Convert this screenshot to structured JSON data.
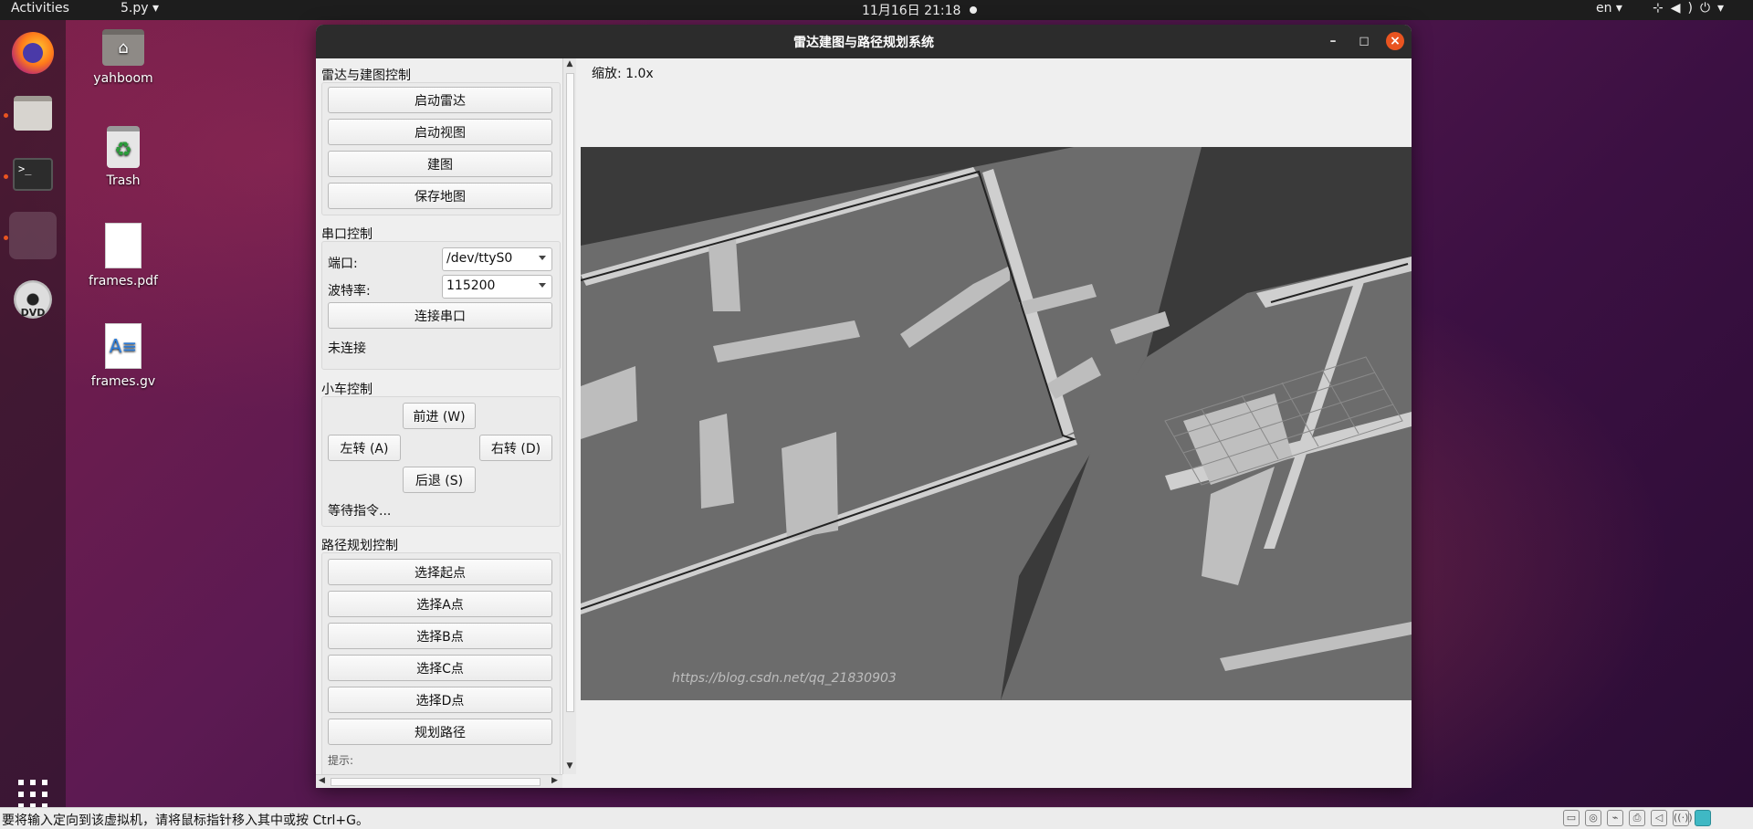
{
  "topbar": {
    "activities": "Activities",
    "app_menu": "5.py ▾",
    "clock": "11月16日  21:18",
    "language": "en ▾",
    "tray_icons": [
      "network-icon",
      "volume-icon",
      "power-icon"
    ]
  },
  "desktop": {
    "icons": [
      {
        "label": "yahboom",
        "icon": "home-folder-icon"
      },
      {
        "label": "Trash",
        "icon": "trash-icon"
      },
      {
        "label": "frames.pdf",
        "icon": "pdf-file-icon"
      },
      {
        "label": "frames.gv",
        "icon": "text-file-icon"
      }
    ]
  },
  "dock": {
    "items": [
      "firefox-icon",
      "files-icon",
      "terminal-icon",
      "python-app-icon",
      "dvd-icon",
      "show-apps-icon"
    ]
  },
  "window": {
    "title": "雷达建图与路径规划系统",
    "controls": {
      "minimize": "–",
      "maximize": "◻",
      "close": "×"
    }
  },
  "radar_group": {
    "title": "雷达与建图控制",
    "buttons": [
      "启动雷达",
      "启动视图",
      "建图",
      "保存地图"
    ]
  },
  "serial_group": {
    "title": "串口控制",
    "port_label": "端口:",
    "port_value": "/dev/ttyS0",
    "baud_label": "波特率:",
    "baud_value": "115200",
    "connect_button": "连接串口",
    "status": "未连接"
  },
  "car_group": {
    "title": "小车控制",
    "forward": "前进 (W)",
    "left": "左转 (A)",
    "right": "右转 (D)",
    "backward": "后退 (S)",
    "status": "等待指令..."
  },
  "path_group": {
    "title": "路径规划控制",
    "buttons": [
      "选择起点",
      "选择A点",
      "选择B点",
      "选择C点",
      "选择D点",
      "规划路径"
    ],
    "hint_label": "提示:"
  },
  "map": {
    "zoom_label": "缩放: 1.0x",
    "watermark": "https://blog.csdn.net/qq_21830903"
  },
  "statusbar": {
    "message": "要将输入定向到该虚拟机，请将鼠标指针移入其中或按 Ctrl+G。"
  },
  "colors": {
    "accent": "#e95420",
    "titlebar": "#2c2c2c",
    "map_dark": "#3a3a3a",
    "map_unknown": "#6e6e6e",
    "map_free": "#c8c8c8"
  }
}
